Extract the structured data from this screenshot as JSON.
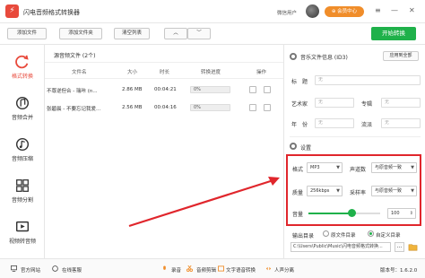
{
  "app": {
    "title": "闪电音频格式转换器",
    "logo_char": "⚡",
    "wechat_login": "微信用户",
    "vip_label": "⊕ 会员中心",
    "window_controls": [
      "≡",
      "—",
      "✕"
    ]
  },
  "toolbar": {
    "add_file": "添加文件",
    "add_folder": "添加文件夹",
    "clear_list": "清空列表",
    "up": "︿",
    "down": "﹀",
    "start": "开始转换"
  },
  "sidebar": {
    "items": [
      {
        "label": "格式转换",
        "icon": "refresh-icon",
        "active": true
      },
      {
        "label": "音频合并",
        "icon": "merge-icon",
        "active": false
      },
      {
        "label": "音频压缩",
        "icon": "compress-icon",
        "active": false
      },
      {
        "label": "音频分割",
        "icon": "split-icon",
        "active": false
      },
      {
        "label": "视频转音频",
        "icon": "video-icon",
        "active": false
      }
    ]
  },
  "filelist": {
    "title": "源音频文件 (2个)",
    "columns": [
      "文件名",
      "大小",
      "时长",
      "转换进度",
      "操作"
    ],
    "rows": [
      {
        "name": "不尊逆但合 - 瑞咔 (n...",
        "size": "2.86 MB",
        "duration": "00:04:21",
        "progress": "0%",
        "progress_value": 0
      },
      {
        "name": "张碧晨 - 不要忘记我爱...",
        "size": "2.56 MB",
        "duration": "00:04:16",
        "progress": "0%",
        "progress_value": 0
      }
    ]
  },
  "info": {
    "title": "音乐文件信息 (ID3)",
    "apply_all": "应用到全部",
    "fields": [
      {
        "label": "标　题",
        "value": "无"
      },
      {
        "label": "艺术家",
        "value": "无"
      },
      {
        "label": "专辑",
        "value": "无"
      },
      {
        "label": "年　份",
        "value": "无"
      },
      {
        "label": "流派",
        "value": "无"
      }
    ]
  },
  "settings": {
    "title": "设置",
    "format_label": "格式",
    "format_value": "MP3",
    "channel_label": "声道数",
    "channel_value": "与原音频一致",
    "quality_label": "质量",
    "quality_value": "256kbps",
    "samplerate_label": "采样率",
    "samplerate_value": "与原音频一致",
    "volume_label": "音量",
    "volume_value": "100",
    "volume_level": 0.6,
    "output_label": "输出目录",
    "output_opt1": "原文件目录",
    "output_opt2": "自定义目录",
    "output_path": "C:\\Users\\Public\\Music\\闪电音频格式转换...",
    "dots": "..."
  },
  "bottom": {
    "website": "官方网站",
    "service": "在线客服",
    "record": "录音",
    "edit": "音频剪辑",
    "tts": "文字语音转换",
    "share": "人声分离",
    "version": "版本号：1.6.2.0"
  },
  "colors": {
    "accent_red": "#e84a3c",
    "green": "#1fb14a",
    "vip_orange": "#f08d2a",
    "highlight_red": "#e0262c"
  }
}
